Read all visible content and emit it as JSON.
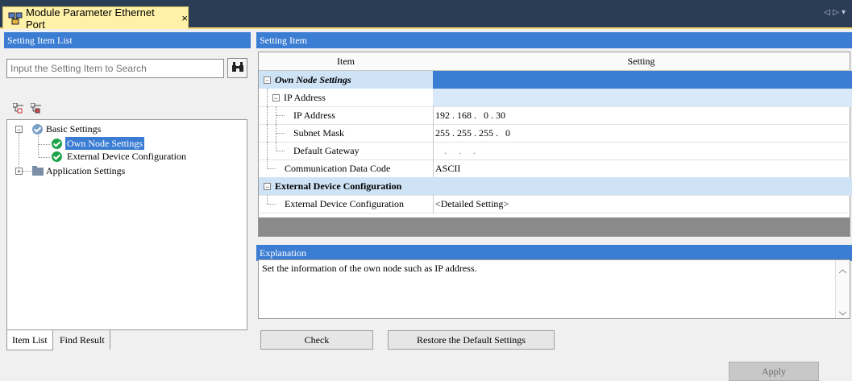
{
  "tab": {
    "title": "Module Parameter Ethernet Port",
    "close": "×",
    "nav": "◁ ▷ ▾"
  },
  "left": {
    "header": "Setting Item List",
    "search_placeholder": "Input the Setting Item to Search",
    "tree": {
      "basic": "Basic Settings",
      "own_node": "Own Node Settings",
      "external": "External Device Configuration",
      "application": "Application Settings"
    },
    "bottom_tabs": [
      "Item List",
      "Find Result"
    ]
  },
  "right": {
    "header": "Setting Item",
    "columns": {
      "item": "Item",
      "setting": "Setting"
    },
    "rows": {
      "own_node": "Own Node Settings",
      "ip_group": "IP Address",
      "ip_address": {
        "label": "IP Address",
        "value": "192 . 168 .   0 . 30"
      },
      "subnet": {
        "label": "Subnet Mask",
        "value": "255 . 255 . 255 .   0"
      },
      "gateway": {
        "label": "Default Gateway",
        "value": ".     .     ."
      },
      "comm_code": {
        "label": "Communication Data Code",
        "value": "ASCII"
      },
      "ext_group": "External Device Configuration",
      "ext_item": {
        "label": "External Device Configuration",
        "value": "<Detailed Setting>"
      }
    },
    "explanation_header": "Explanation",
    "explanation_text": "Set the information of the own node such as IP address."
  },
  "buttons": {
    "check": "Check",
    "restore": "Restore the Default Settings",
    "apply": "Apply"
  },
  "colors": {
    "accent": "#3b7dd3",
    "titlebar": "#2b3d55",
    "tab": "#fff2a8",
    "check": "#1ea34a"
  },
  "icons": [
    "network-module-icon",
    "search-binoculars-icon",
    "expand-all-icon",
    "collapse-all-icon",
    "check-circle-icon",
    "folder-icon"
  ]
}
